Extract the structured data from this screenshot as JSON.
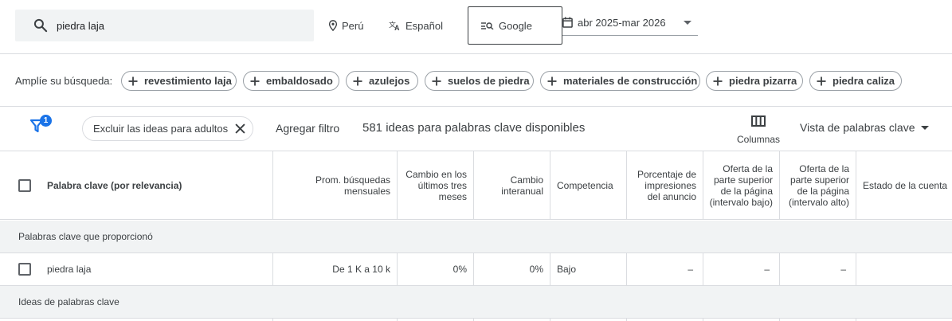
{
  "search": {
    "query": "piedra laja"
  },
  "targeting": {
    "location": "Perú",
    "language": "Español",
    "network": "Google",
    "date_range": "abr 2025-mar 2026"
  },
  "broaden": {
    "label": "Amplíe su búsqueda:",
    "chips": [
      "revestimiento laja",
      "embaldosado",
      "azulejos",
      "suelos de piedra",
      "materiales de construcción",
      "piedra pizarra",
      "piedra caliza"
    ]
  },
  "toolbar": {
    "filter_badge": "1",
    "active_filter": "Excluir las ideas para adultos",
    "add_filter": "Agregar filtro",
    "ideas_count": "581 ideas para palabras clave disponibles",
    "columns": "Columnas",
    "view": "Vista de palabras clave"
  },
  "table": {
    "columns": {
      "keyword": "Palabra clave (por relevancia)",
      "avg_searches": "Prom. búsquedas mensuales",
      "three_month_change": "Cambio en los últimos tres meses",
      "yoy_change": "Cambio interanual",
      "competition": "Competencia",
      "impression_share": "Porcentaje de impresiones del anuncio",
      "bid_low": "Oferta de la parte superior de la página (intervalo bajo)",
      "bid_high": "Oferta de la parte superior de la página (intervalo alto)",
      "account_status": "Estado de la cuenta"
    },
    "groups": {
      "provided": "Palabras clave que proporcionó",
      "ideas": "Ideas de palabras clave"
    },
    "rows": [
      {
        "keyword": "piedra laja",
        "avg_searches": "De 1 K a 10 k",
        "three_month_change": "0%",
        "yoy_change": "0%",
        "competition": "Bajo",
        "impression_share": "–",
        "bid_low": "–",
        "bid_high": "–",
        "account_status": ""
      }
    ]
  },
  "icons": {
    "search": "search-icon",
    "location": "location-pin-icon",
    "language": "translate-icon",
    "network": "search-network-icon",
    "calendar": "calendar-icon",
    "filter": "filter-icon",
    "columns": "columns-icon"
  },
  "colors": {
    "accent": "#1a73e8",
    "text": "#3c4043",
    "border": "#dadce0",
    "group_bg": "#f1f3f4"
  }
}
